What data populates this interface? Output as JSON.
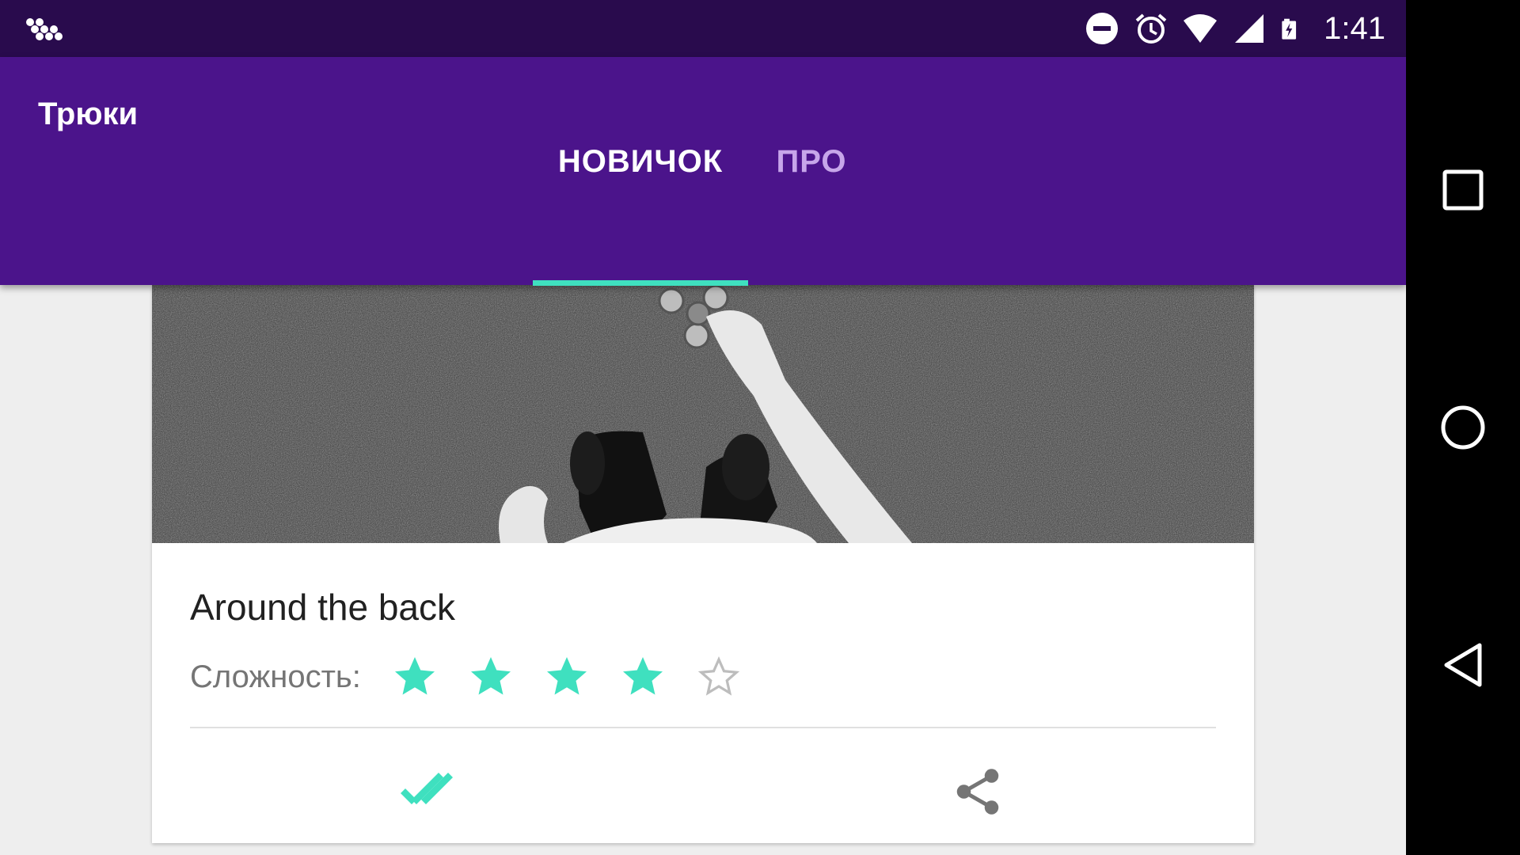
{
  "app": {
    "title": "Трюки"
  },
  "status_bar": {
    "time": "1:41",
    "icons": [
      "app-notification-icon",
      "do-not-disturb-icon",
      "alarm-icon",
      "wifi-icon",
      "signal-icon",
      "battery-charging-icon"
    ]
  },
  "tabs": [
    {
      "label": "НОВИЧОК",
      "selected": true
    },
    {
      "label": "ПРО",
      "selected": false
    }
  ],
  "card": {
    "image": "trick-video-thumbnail",
    "title": "Around the back",
    "difficulty_label": "Сложность:",
    "rating": 4,
    "rating_max": 5,
    "actions": [
      "done-all-icon",
      "share-icon"
    ]
  },
  "colors": {
    "status_bar": "#290b4d",
    "primary": "#4b148b",
    "accent": "#3fe0bf",
    "inactive_tab": "#c7a6ea",
    "background": "#eeeeee"
  },
  "nav_bar": {
    "buttons": [
      "recents-icon",
      "home-icon",
      "back-icon"
    ]
  }
}
